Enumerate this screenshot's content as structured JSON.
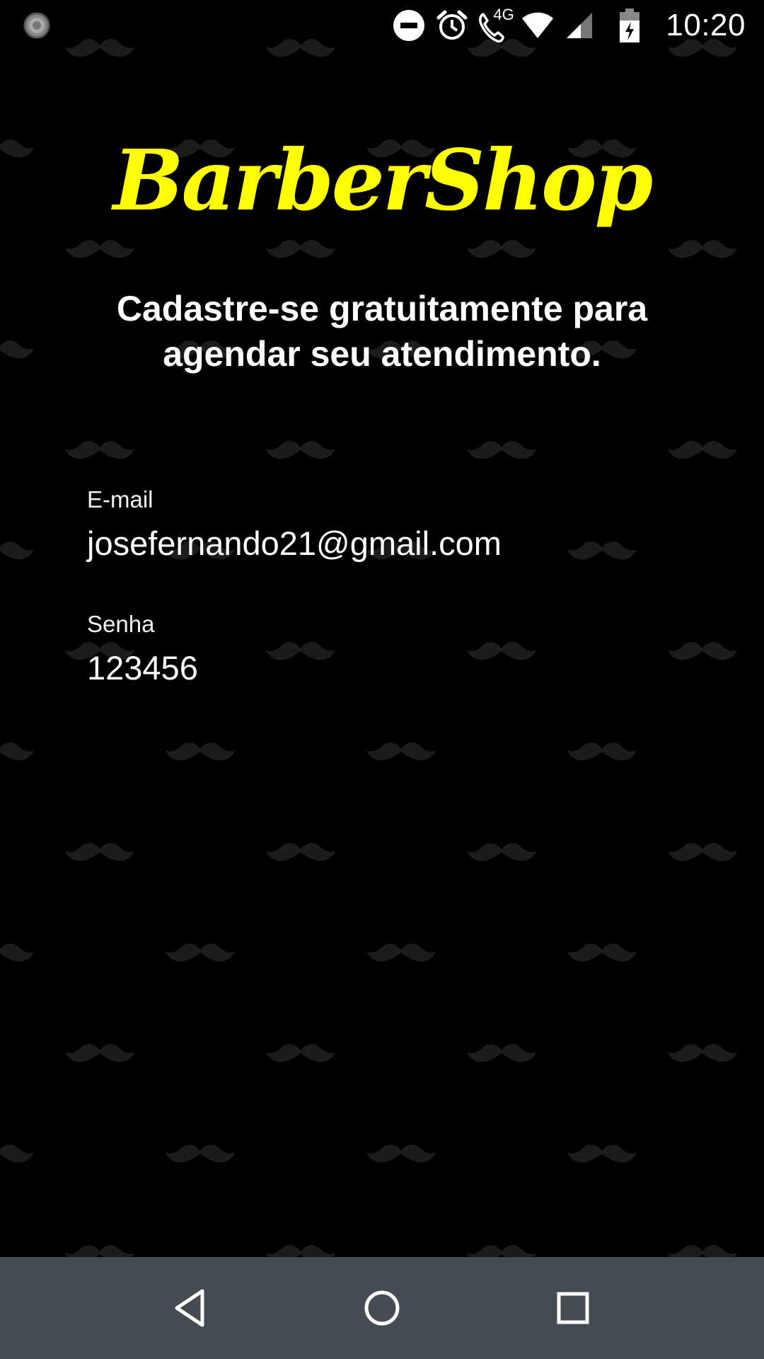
{
  "status_bar": {
    "time": "10:20",
    "network_label": "4G",
    "icons": [
      "loading-indicator-icon",
      "do-not-disturb-icon",
      "alarm-icon",
      "wifi-calling-icon",
      "wifi-icon",
      "cell-signal-icon",
      "battery-charging-icon"
    ]
  },
  "header": {
    "logo": "BarberShop",
    "logo_color": "#ffff00",
    "subtitle": "Cadastre-se gratuitamente para agendar seu atendimento."
  },
  "form": {
    "email": {
      "label": "E-mail",
      "value": "josefernando21@gmail.com"
    },
    "password": {
      "label": "Senha",
      "value": "123456"
    }
  },
  "nav_bar": {
    "background": "#454c54",
    "buttons": [
      "back-icon",
      "home-icon",
      "recents-icon"
    ]
  },
  "background": {
    "color": "#000000",
    "pattern": "mustache-icon"
  }
}
